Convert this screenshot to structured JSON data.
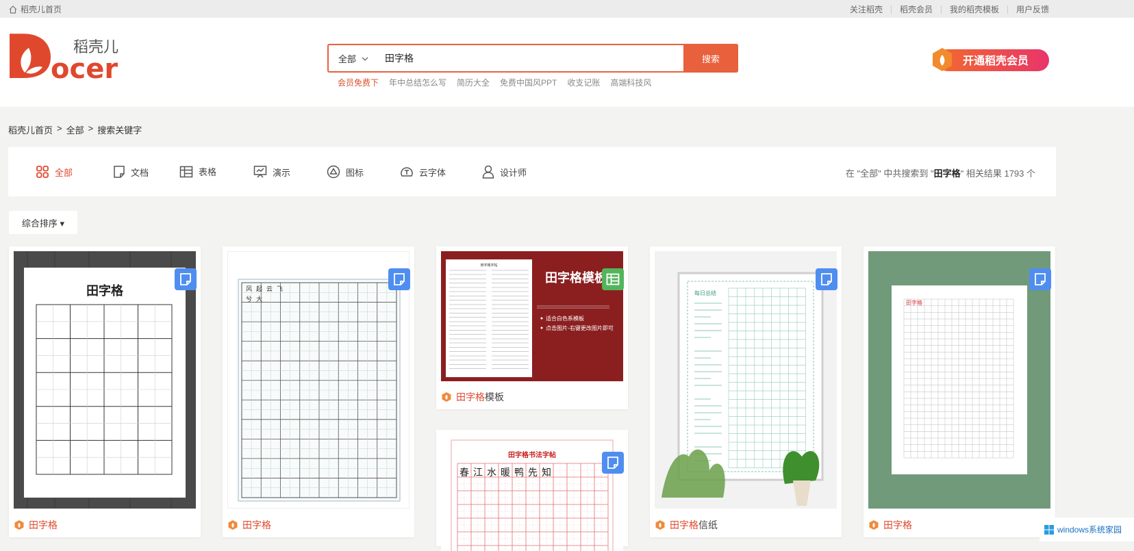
{
  "topbar": {
    "home_label": "稻壳儿首页",
    "links": [
      "关注稻壳",
      "稻壳会员",
      "我的稻壳模板",
      "用户反馈"
    ]
  },
  "logo": {
    "text_cn": "稻壳儿",
    "text_en": "ocer"
  },
  "search": {
    "scope": "全部",
    "value": "田字格",
    "button": "搜索",
    "hotwords": [
      "会员免费下",
      "年中总结怎么写",
      "简历大全",
      "免费中国风PPT",
      "收支记账",
      "高端科技风"
    ]
  },
  "vip_banner": "开通稻壳会员",
  "breadcrumb": [
    "稻壳儿首页",
    ">",
    "全部",
    ">",
    "搜索关键字"
  ],
  "tabs": [
    {
      "label": "全部",
      "icon": "grid-icon",
      "active": true
    },
    {
      "label": "文档",
      "icon": "document-icon"
    },
    {
      "label": "表格",
      "icon": "table-icon"
    },
    {
      "label": "演示",
      "icon": "presentation-icon"
    },
    {
      "label": "图标",
      "icon": "triangle-circle-icon"
    },
    {
      "label": "云字体",
      "icon": "font-cloud-icon"
    },
    {
      "label": "设计师",
      "icon": "user-icon"
    }
  ],
  "result_count": {
    "prefix": "在 \"全部\" 中共搜索到 \"",
    "keyword": "田字格",
    "suffix": "\" 相关结果 1793 个"
  },
  "sort_label": "综合排序 ▾",
  "cards": [
    {
      "keyword": "田字格",
      "rest": "",
      "type": "document",
      "thumb_title": "田字格"
    },
    {
      "keyword": "田字格",
      "rest": "",
      "type": "document",
      "thumb_chars": [
        "风",
        "起",
        "云",
        "飞",
        "兮",
        "大"
      ]
    },
    {
      "keyword": "田字格",
      "rest": "模板",
      "type": "spreadsheet",
      "thumb_title": "田字格模板",
      "bullets": [
        "适合白色系模板",
        "点击图片-右键更改图片即可"
      ],
      "mini_title": "田字格字帖"
    },
    {
      "keyword": "田字格",
      "rest": "信纸",
      "type": "document",
      "thumb_title": "每日总结"
    },
    {
      "keyword": "田字格",
      "rest": "",
      "type": "document",
      "thumb_title": "田字格"
    },
    {
      "keyword": "",
      "rest": "",
      "type": "document",
      "thumb_title": "田字格书法字帖",
      "thumb_chars": [
        "春",
        "江",
        "水",
        "暖",
        "鸭",
        "先",
        "知"
      ]
    }
  ],
  "watermark": "windows系统家园"
}
